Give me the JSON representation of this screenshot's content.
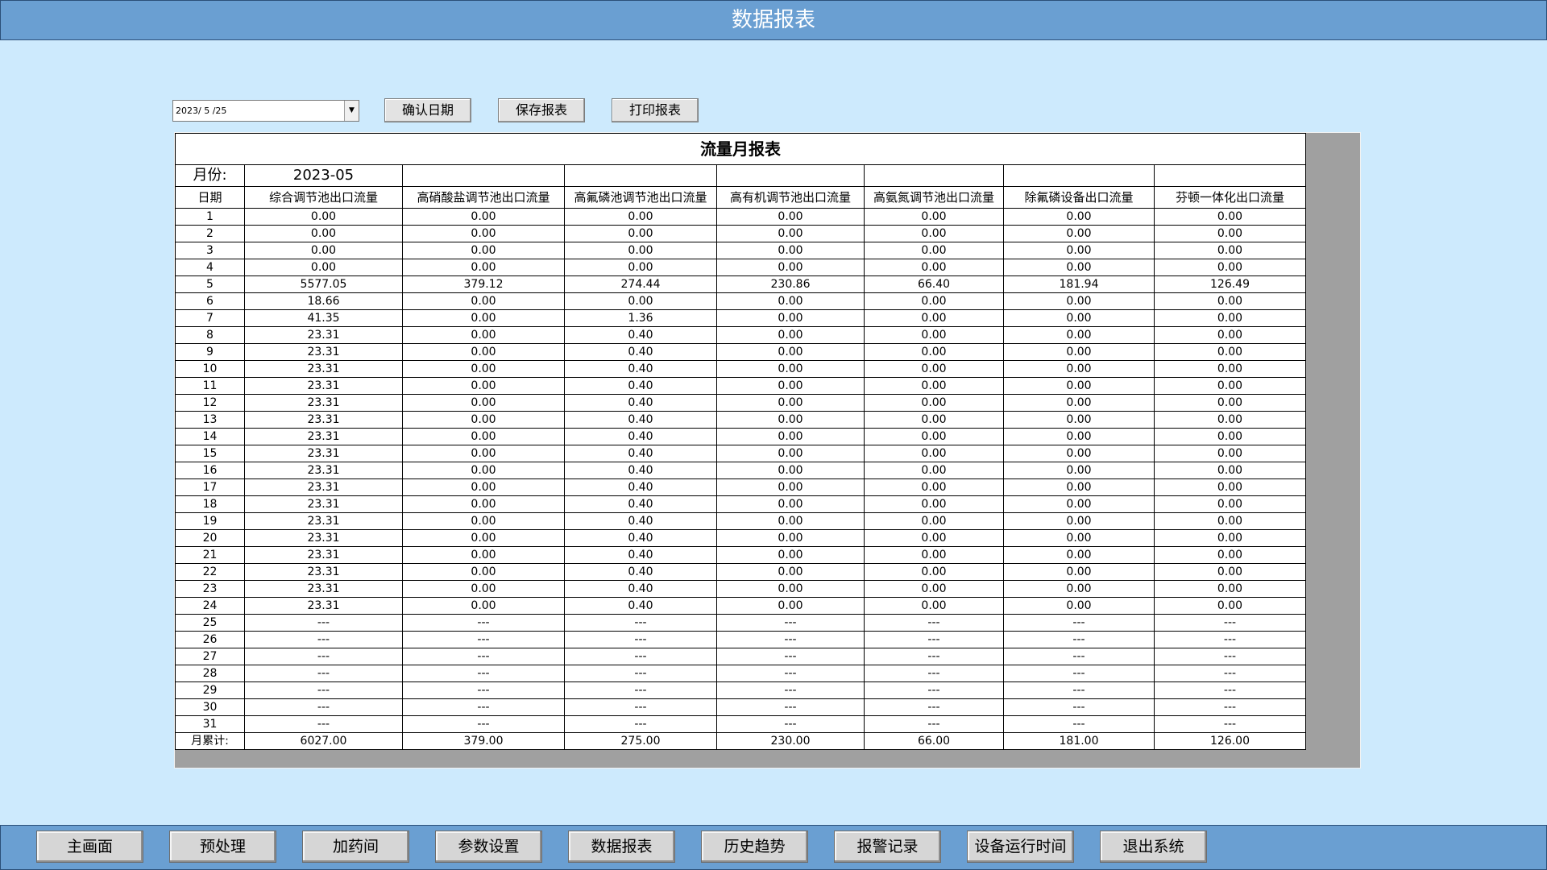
{
  "window": {
    "title": "数据报表"
  },
  "toolbar": {
    "date_value": "2023/ 5 /25",
    "confirm_label": "确认日期",
    "save_label": "保存报表",
    "print_label": "打印报表"
  },
  "report": {
    "title": "流量月报表",
    "month_label": "月份:",
    "month_value": "2023-05",
    "columns": [
      "日期",
      "综合调节池出口流量",
      "高硝酸盐调节池出口流量",
      "高氟磷池调节池出口流量",
      "高有机调节池出口流量",
      "高氨氮调节池出口流量",
      "除氟磷设备出口流量",
      "芬顿一体化出口流量"
    ],
    "rows": [
      [
        "1",
        "0.00",
        "0.00",
        "0.00",
        "0.00",
        "0.00",
        "0.00",
        "0.00"
      ],
      [
        "2",
        "0.00",
        "0.00",
        "0.00",
        "0.00",
        "0.00",
        "0.00",
        "0.00"
      ],
      [
        "3",
        "0.00",
        "0.00",
        "0.00",
        "0.00",
        "0.00",
        "0.00",
        "0.00"
      ],
      [
        "4",
        "0.00",
        "0.00",
        "0.00",
        "0.00",
        "0.00",
        "0.00",
        "0.00"
      ],
      [
        "5",
        "5577.05",
        "379.12",
        "274.44",
        "230.86",
        "66.40",
        "181.94",
        "126.49"
      ],
      [
        "6",
        "18.66",
        "0.00",
        "0.00",
        "0.00",
        "0.00",
        "0.00",
        "0.00"
      ],
      [
        "7",
        "41.35",
        "0.00",
        "1.36",
        "0.00",
        "0.00",
        "0.00",
        "0.00"
      ],
      [
        "8",
        "23.31",
        "0.00",
        "0.40",
        "0.00",
        "0.00",
        "0.00",
        "0.00"
      ],
      [
        "9",
        "23.31",
        "0.00",
        "0.40",
        "0.00",
        "0.00",
        "0.00",
        "0.00"
      ],
      [
        "10",
        "23.31",
        "0.00",
        "0.40",
        "0.00",
        "0.00",
        "0.00",
        "0.00"
      ],
      [
        "11",
        "23.31",
        "0.00",
        "0.40",
        "0.00",
        "0.00",
        "0.00",
        "0.00"
      ],
      [
        "12",
        "23.31",
        "0.00",
        "0.40",
        "0.00",
        "0.00",
        "0.00",
        "0.00"
      ],
      [
        "13",
        "23.31",
        "0.00",
        "0.40",
        "0.00",
        "0.00",
        "0.00",
        "0.00"
      ],
      [
        "14",
        "23.31",
        "0.00",
        "0.40",
        "0.00",
        "0.00",
        "0.00",
        "0.00"
      ],
      [
        "15",
        "23.31",
        "0.00",
        "0.40",
        "0.00",
        "0.00",
        "0.00",
        "0.00"
      ],
      [
        "16",
        "23.31",
        "0.00",
        "0.40",
        "0.00",
        "0.00",
        "0.00",
        "0.00"
      ],
      [
        "17",
        "23.31",
        "0.00",
        "0.40",
        "0.00",
        "0.00",
        "0.00",
        "0.00"
      ],
      [
        "18",
        "23.31",
        "0.00",
        "0.40",
        "0.00",
        "0.00",
        "0.00",
        "0.00"
      ],
      [
        "19",
        "23.31",
        "0.00",
        "0.40",
        "0.00",
        "0.00",
        "0.00",
        "0.00"
      ],
      [
        "20",
        "23.31",
        "0.00",
        "0.40",
        "0.00",
        "0.00",
        "0.00",
        "0.00"
      ],
      [
        "21",
        "23.31",
        "0.00",
        "0.40",
        "0.00",
        "0.00",
        "0.00",
        "0.00"
      ],
      [
        "22",
        "23.31",
        "0.00",
        "0.40",
        "0.00",
        "0.00",
        "0.00",
        "0.00"
      ],
      [
        "23",
        "23.31",
        "0.00",
        "0.40",
        "0.00",
        "0.00",
        "0.00",
        "0.00"
      ],
      [
        "24",
        "23.31",
        "0.00",
        "0.40",
        "0.00",
        "0.00",
        "0.00",
        "0.00"
      ],
      [
        "25",
        "---",
        "---",
        "---",
        "---",
        "---",
        "---",
        "---"
      ],
      [
        "26",
        "---",
        "---",
        "---",
        "---",
        "---",
        "---",
        "---"
      ],
      [
        "27",
        "---",
        "---",
        "---",
        "---",
        "---",
        "---",
        "---"
      ],
      [
        "28",
        "---",
        "---",
        "---",
        "---",
        "---",
        "---",
        "---"
      ],
      [
        "29",
        "---",
        "---",
        "---",
        "---",
        "---",
        "---",
        "---"
      ],
      [
        "30",
        "---",
        "---",
        "---",
        "---",
        "---",
        "---",
        "---"
      ],
      [
        "31",
        "---",
        "---",
        "---",
        "---",
        "---",
        "---",
        "---"
      ]
    ],
    "total": [
      "月累计:",
      "6027.00",
      "379.00",
      "275.00",
      "230.00",
      "66.00",
      "181.00",
      "126.00"
    ]
  },
  "nav": {
    "items": [
      "主画面",
      "预处理",
      "加药间",
      "参数设置",
      "数据报表",
      "历史趋势",
      "报警记录",
      "设备运行时间",
      "退出系统"
    ]
  },
  "colors": {
    "background": "#cdeafd",
    "bar": "#6a9fd2",
    "panel": "#a0a0a0"
  }
}
